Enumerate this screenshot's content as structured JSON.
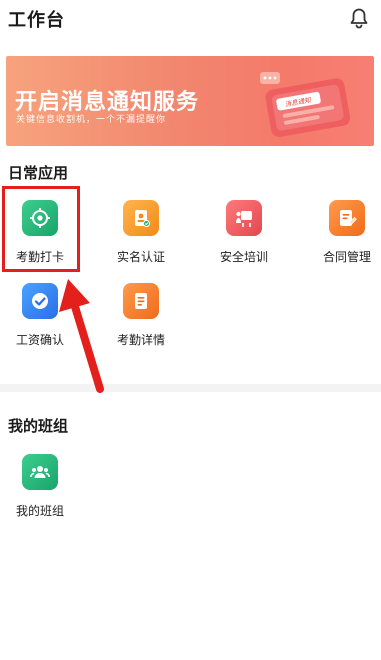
{
  "header": {
    "title": "工作台",
    "bell_icon": "bell-icon"
  },
  "banner": {
    "headline": "开启消息通知服务",
    "subtitle": "关键信息收割机，一个不漏提醒你",
    "card_label": "消息通知",
    "colors": {
      "start": "#f7a37d",
      "end": "#f77f73"
    }
  },
  "daily_apps": {
    "title": "日常应用",
    "items": [
      {
        "label": "考勤打卡",
        "icon": "target-icon",
        "color": "#1aa36b"
      },
      {
        "label": "实名认证",
        "icon": "id-badge-icon",
        "color": "#f28a1a"
      },
      {
        "label": "安全培训",
        "icon": "training-board-icon",
        "color": "#e2474f"
      },
      {
        "label": "合同管理",
        "icon": "contract-edit-icon",
        "color": "#f06b1a"
      },
      {
        "label": "工资确认",
        "icon": "check-shield-icon",
        "color": "#2b6de8"
      },
      {
        "label": "考勤详情",
        "icon": "document-list-icon",
        "color": "#f06b1a"
      }
    ]
  },
  "my_team": {
    "title": "我的班组",
    "items": [
      {
        "label": "我的班组",
        "icon": "group-icon",
        "color": "#1aa36b"
      }
    ]
  },
  "annotation": {
    "highlight_color": "#e3201b"
  }
}
